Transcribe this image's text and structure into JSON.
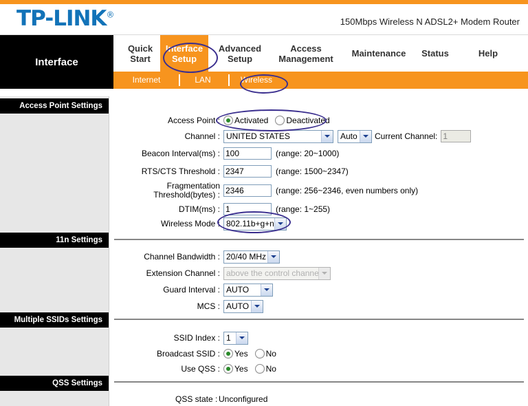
{
  "header": {
    "logo": "TP-LINK",
    "logo_mark": "®",
    "model": "150Mbps Wireless N ADSL2+ Modem Router"
  },
  "nav": {
    "section_label": "Interface",
    "items": [
      {
        "label": "Quick\nStart",
        "active": false
      },
      {
        "label": "Interface\nSetup",
        "active": true
      },
      {
        "label": "Advanced\nSetup",
        "active": false
      },
      {
        "label": "Access\nManagement",
        "active": false
      },
      {
        "label": "Maintenance",
        "active": false
      },
      {
        "label": "Status",
        "active": false
      },
      {
        "label": "Help",
        "active": false
      }
    ],
    "subnav": [
      {
        "label": "Internet",
        "active": false
      },
      {
        "label": "LAN",
        "active": false
      },
      {
        "label": "Wireless",
        "active": true
      }
    ]
  },
  "sections": {
    "access_point": "Access Point Settings",
    "eleven_n": "11n Settings",
    "multiple_ssids": "Multiple SSIDs Settings",
    "qss": "QSS Settings"
  },
  "access_point": {
    "access_point_label": "Access Point :",
    "activated_label": "Activated",
    "deactivated_label": "Deactivated",
    "access_point_value": "Activated",
    "channel_label": "Channel :",
    "channel_value": "UNITED STATES",
    "channel_number_value": "Auto",
    "current_channel_label": "Current Channel:",
    "current_channel_value": "1",
    "beacon_label": "Beacon Interval(ms) :",
    "beacon_value": "100",
    "beacon_hint": "(range: 20~1000)",
    "rts_label": "RTS/CTS Threshold :",
    "rts_value": "2347",
    "rts_hint": "(range: 1500~2347)",
    "frag_label": "Fragmentation\nThreshold(bytes) :",
    "frag_value": "2346",
    "frag_hint": "(range: 256~2346, even numbers only)",
    "dtim_label": "DTIM(ms) :",
    "dtim_value": "1",
    "dtim_hint": "(range: 1~255)",
    "wireless_mode_label": "Wireless Mode :",
    "wireless_mode_value": "802.11b+g+n"
  },
  "eleven_n": {
    "bandwidth_label": "Channel Bandwidth :",
    "bandwidth_value": "20/40 MHz",
    "extension_label": "Extension Channel :",
    "extension_value": "above the control channel",
    "guard_label": "Guard Interval :",
    "guard_value": "AUTO",
    "mcs_label": "MCS :",
    "mcs_value": "AUTO"
  },
  "multiple_ssids": {
    "ssid_index_label": "SSID Index :",
    "ssid_index_value": "1",
    "broadcast_label": "Broadcast SSID :",
    "broadcast_value": "Yes",
    "use_qss_label": "Use QSS :",
    "use_qss_value": "Yes",
    "yes_label": "Yes",
    "no_label": "No"
  },
  "qss": {
    "state_label": "QSS state :",
    "state_value": "Unconfigured"
  },
  "colors": {
    "accent_orange": "#f7941e",
    "brand_blue": "#1273b8",
    "annotation": "#3b2f8f",
    "sidebar_gray": "#e7e7e7"
  }
}
